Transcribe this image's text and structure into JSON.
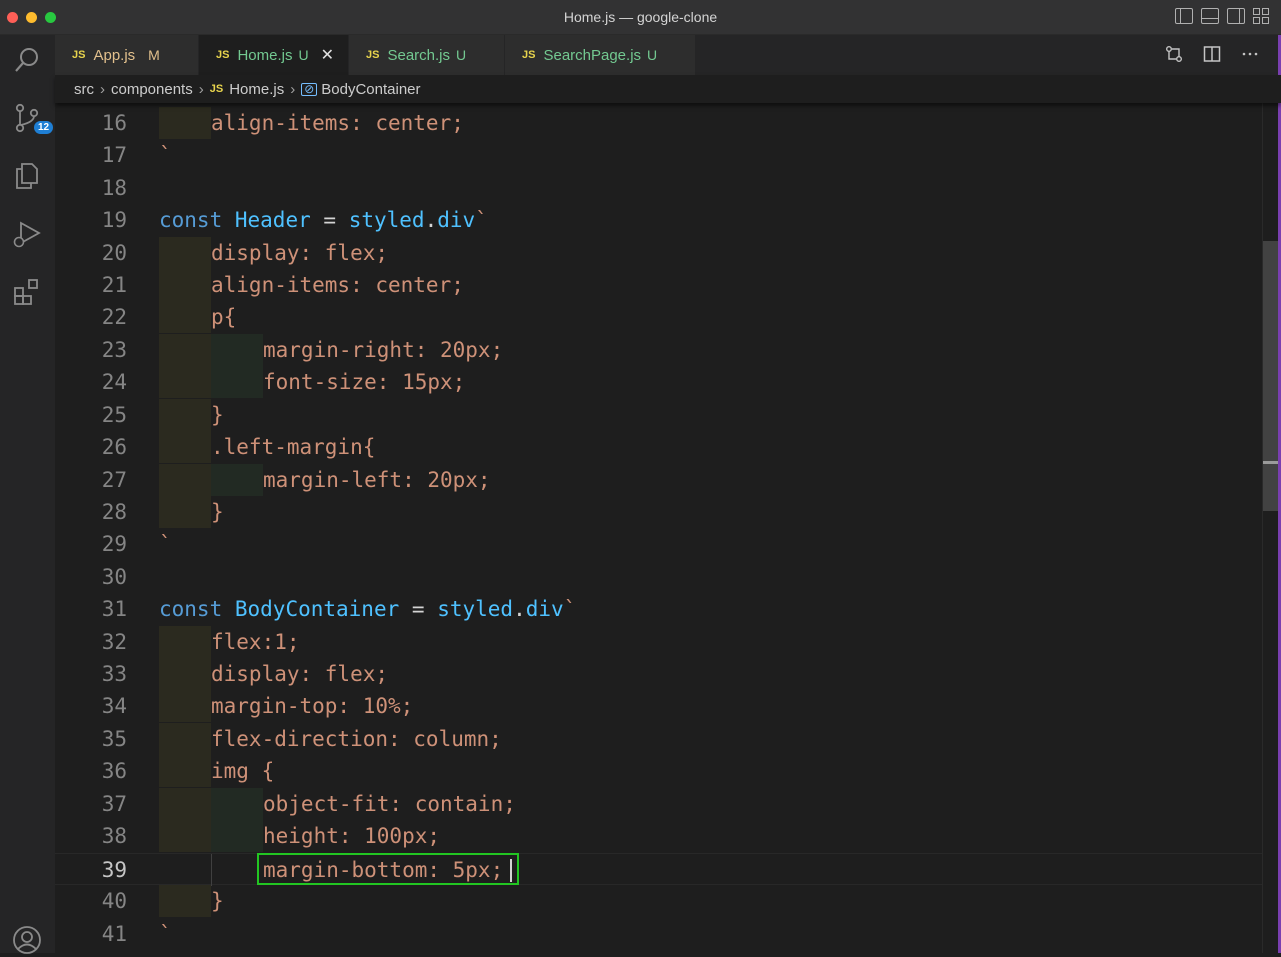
{
  "window": {
    "title": "Home.js — google-clone"
  },
  "tabs": [
    {
      "icon": "JS",
      "name": "App.js",
      "status": "M",
      "active": false
    },
    {
      "icon": "JS",
      "name": "Home.js",
      "status": "U",
      "active": true,
      "close": "✕"
    },
    {
      "icon": "JS",
      "name": "Search.js",
      "status": "U",
      "active": false
    },
    {
      "icon": "JS",
      "name": "SearchPage.js",
      "status": "U",
      "active": false
    }
  ],
  "breadcrumb": {
    "folder1": "src",
    "folder2": "components",
    "file_icon": "JS",
    "file": "Home.js",
    "symbol_icon": "[⊘]",
    "symbol": "BodyContainer"
  },
  "activity": {
    "scm_badge": "12"
  },
  "editor": {
    "current_line": 39,
    "lines": [
      {
        "n": "16",
        "t": "align-items: center;"
      },
      {
        "n": "17",
        "t": "`"
      },
      {
        "n": "18",
        "t": ""
      },
      {
        "n": "19",
        "t": "const Header = styled.div`"
      },
      {
        "n": "20",
        "t": "display: flex;"
      },
      {
        "n": "21",
        "t": "align-items: center;"
      },
      {
        "n": "22",
        "t": "p{"
      },
      {
        "n": "23",
        "t": "margin-right: 20px;"
      },
      {
        "n": "24",
        "t": "font-size: 15px;"
      },
      {
        "n": "25",
        "t": "}"
      },
      {
        "n": "26",
        "t": ".left-margin{"
      },
      {
        "n": "27",
        "t": "margin-left: 20px;"
      },
      {
        "n": "28",
        "t": "}"
      },
      {
        "n": "29",
        "t": "`"
      },
      {
        "n": "30",
        "t": ""
      },
      {
        "n": "31",
        "t": "const BodyContainer = styled.div`"
      },
      {
        "n": "32",
        "t": "flex:1;"
      },
      {
        "n": "33",
        "t": "display: flex;"
      },
      {
        "n": "34",
        "t": "margin-top: 10%;"
      },
      {
        "n": "35",
        "t": "flex-direction: column;"
      },
      {
        "n": "36",
        "t": "img {"
      },
      {
        "n": "37",
        "t": "object-fit: contain;"
      },
      {
        "n": "38",
        "t": "height: 100px;"
      },
      {
        "n": "39",
        "t": "margin-bottom: 5px;"
      },
      {
        "n": "40",
        "t": "}"
      },
      {
        "n": "41",
        "t": "`"
      }
    ]
  },
  "icons": {
    "explorer": "explorer-icon",
    "search": "search-icon",
    "scm": "source-control-icon",
    "debug": "run-debug-icon",
    "extensions": "extensions-icon",
    "account": "account-icon"
  },
  "colors": {
    "keyword": "#569cd6",
    "variable": "#4fc1ff",
    "string": "#ce9178",
    "highlight_box": "#22c522",
    "modified": "#e2c08d",
    "untracked": "#73c991"
  }
}
